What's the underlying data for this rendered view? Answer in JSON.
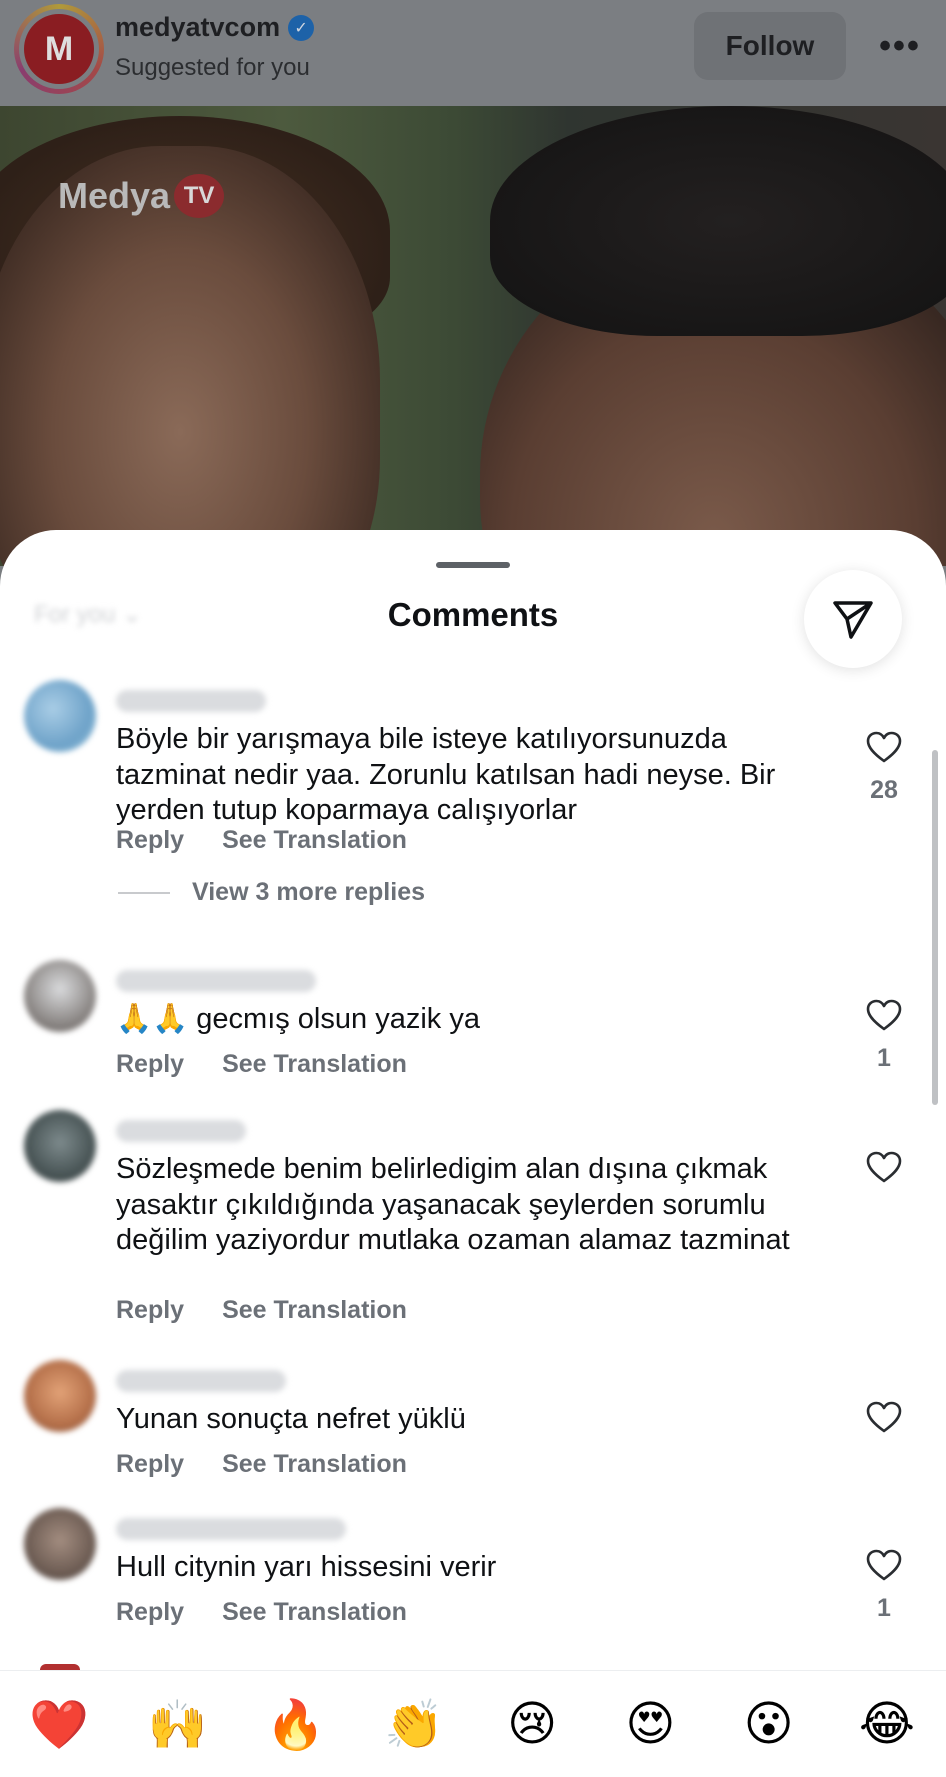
{
  "header": {
    "account_name": "medyatvcom",
    "account_logo_letter": "M",
    "subtitle": "Suggested for you",
    "follow_label": "Follow",
    "more_label": "•••"
  },
  "post": {
    "watermark_text": "Medya",
    "watermark_badge": "TV"
  },
  "sheet": {
    "title": "Comments",
    "sort_label": "For you"
  },
  "comments": [
    {
      "text": "Böyle bir yarışmaya bile isteye katılıyorsunuzda tazminat nedir yaa. Zorunlu katılsan hadi neyse. Bir yerden tutup koparmaya calışıyorlar",
      "reply_label": "Reply",
      "translate_label": "See Translation",
      "likes": "28",
      "view_replies": "View 3 more replies"
    },
    {
      "text": "🙏🙏 gecmış olsun yazik ya",
      "reply_label": "Reply",
      "translate_label": "See Translation",
      "likes": "1"
    },
    {
      "text": "Sözleşmede benim belirledigim alan dışına çıkmak yasaktır çıkıldığında  yaşanacak şeylerden sorumlu değilim yaziyordur mutlaka ozaman alamaz tazminat",
      "reply_label": "Reply",
      "translate_label": "See Translation",
      "likes": ""
    },
    {
      "text": "Yunan sonuçta nefret yüklü",
      "reply_label": "Reply",
      "translate_label": "See Translation",
      "likes": ""
    },
    {
      "text": "Hull citynin yarı hissesini verir",
      "reply_label": "Reply",
      "translate_label": "See Translation",
      "likes": "1"
    }
  ],
  "emoji_bar": [
    "❤️",
    "🙌",
    "🔥",
    "👏",
    "😢",
    "😍",
    "😮",
    "😂"
  ],
  "colors": {
    "text_primary": "#0f1114",
    "text_secondary": "#6b7077",
    "sheet_bg": "#ffffff",
    "verified_blue": "#1d62a8"
  }
}
